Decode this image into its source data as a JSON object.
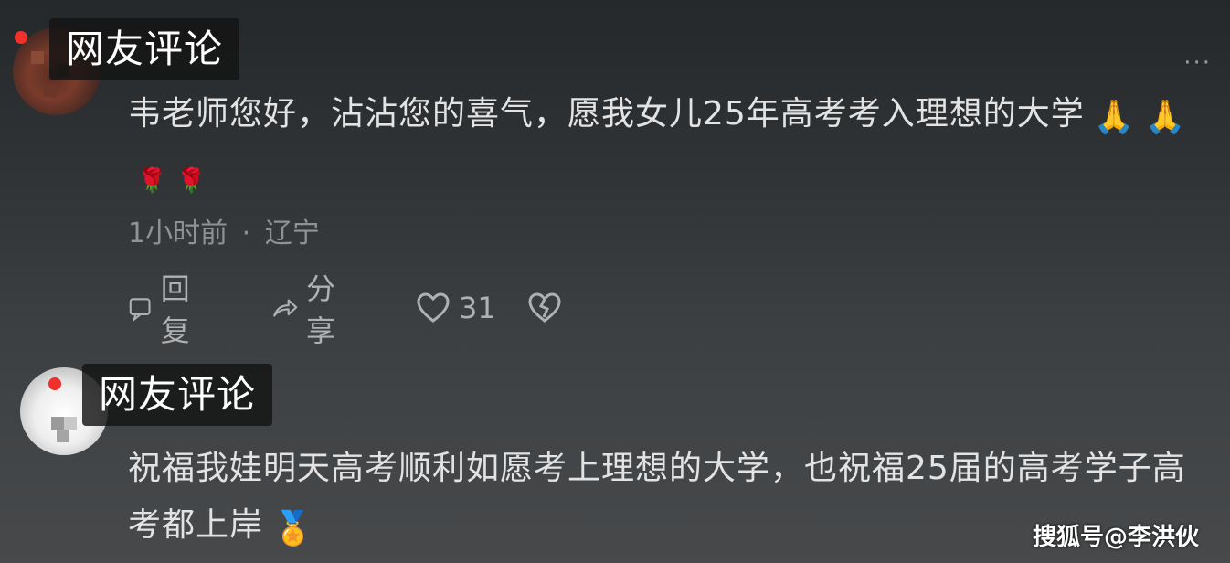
{
  "colors": {
    "tag_bg": "#141414",
    "red_dot": "#f2302b",
    "text": "#e3e3e3",
    "meta": "#8f9294"
  },
  "comments": [
    {
      "tag": "网友评论",
      "text": "韦老师您好，沾沾您的喜气，愿我女儿25年高考考入理想的大学",
      "emojis": [
        "🙏",
        "🙏",
        "🌹",
        "🌹"
      ],
      "time": "1小时前",
      "location": "辽宁",
      "separator": "·",
      "actions": {
        "reply": "回复",
        "share": "分享",
        "likes": "31"
      },
      "icons": [
        "comment-icon",
        "share-icon",
        "heart-icon",
        "heartbreak-icon"
      ]
    },
    {
      "tag": "网友评论",
      "text": "祝福我娃明天高考顺利如愿考上理想的大学，也祝福25届的高考学子高考都上岸",
      "emojis": [
        "🏅"
      ]
    }
  ],
  "more_label": "···",
  "watermark": "搜狐号@李洪伙"
}
